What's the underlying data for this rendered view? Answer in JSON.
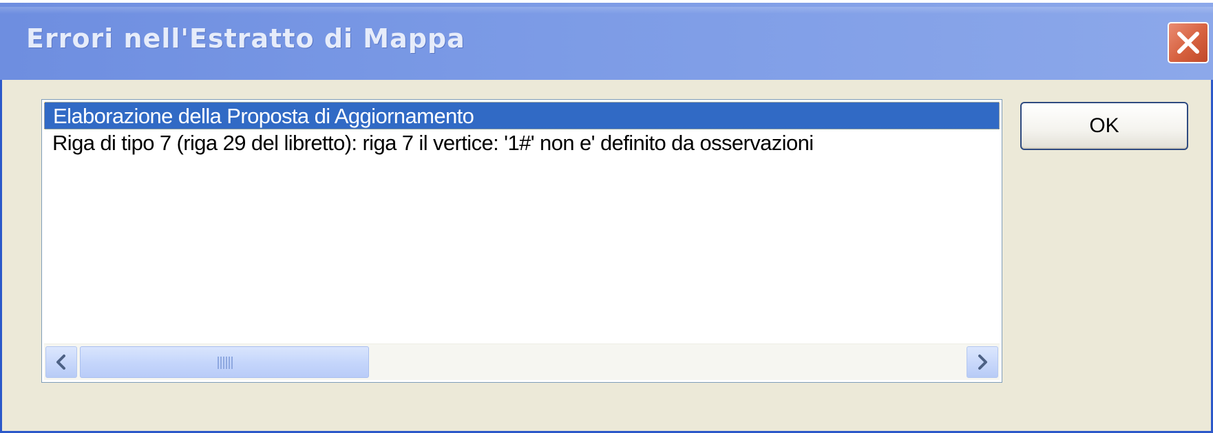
{
  "window": {
    "title": "Errori nell'Estratto di Mappa",
    "close_icon": "close-icon",
    "colors": {
      "titlebar": "#7C9BE6",
      "close": "#D6613F",
      "selection": "#316AC5",
      "face": "#ECE9D8"
    }
  },
  "list": {
    "items": [
      {
        "label": "Elaborazione della Proposta di Aggiornamento",
        "selected": true
      },
      {
        "label": "Riga di tipo  7 (riga 29 del libretto):  riga 7 il vertice: '1#' non e' definito da osservazioni",
        "selected": false
      }
    ],
    "scrollbar": {
      "left_icon": "chevron-left-icon",
      "right_icon": "chevron-right-icon"
    }
  },
  "buttons": {
    "ok_label": "OK"
  }
}
